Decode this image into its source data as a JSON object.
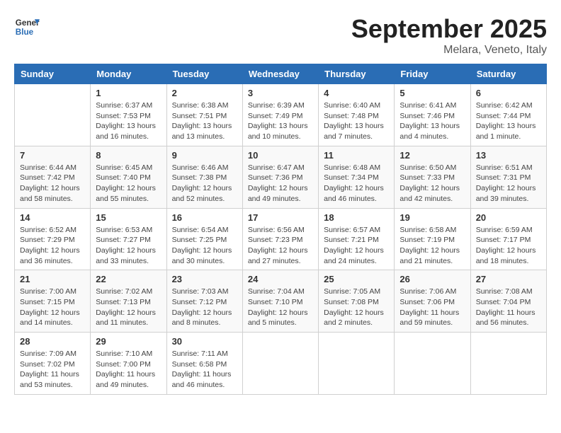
{
  "header": {
    "logo_general": "General",
    "logo_blue": "Blue",
    "month_title": "September 2025",
    "location": "Melara, Veneto, Italy"
  },
  "weekdays": [
    "Sunday",
    "Monday",
    "Tuesday",
    "Wednesday",
    "Thursday",
    "Friday",
    "Saturday"
  ],
  "weeks": [
    [
      {
        "day": "",
        "info": ""
      },
      {
        "day": "1",
        "info": "Sunrise: 6:37 AM\nSunset: 7:53 PM\nDaylight: 13 hours\nand 16 minutes."
      },
      {
        "day": "2",
        "info": "Sunrise: 6:38 AM\nSunset: 7:51 PM\nDaylight: 13 hours\nand 13 minutes."
      },
      {
        "day": "3",
        "info": "Sunrise: 6:39 AM\nSunset: 7:49 PM\nDaylight: 13 hours\nand 10 minutes."
      },
      {
        "day": "4",
        "info": "Sunrise: 6:40 AM\nSunset: 7:48 PM\nDaylight: 13 hours\nand 7 minutes."
      },
      {
        "day": "5",
        "info": "Sunrise: 6:41 AM\nSunset: 7:46 PM\nDaylight: 13 hours\nand 4 minutes."
      },
      {
        "day": "6",
        "info": "Sunrise: 6:42 AM\nSunset: 7:44 PM\nDaylight: 13 hours\nand 1 minute."
      }
    ],
    [
      {
        "day": "7",
        "info": "Sunrise: 6:44 AM\nSunset: 7:42 PM\nDaylight: 12 hours\nand 58 minutes."
      },
      {
        "day": "8",
        "info": "Sunrise: 6:45 AM\nSunset: 7:40 PM\nDaylight: 12 hours\nand 55 minutes."
      },
      {
        "day": "9",
        "info": "Sunrise: 6:46 AM\nSunset: 7:38 PM\nDaylight: 12 hours\nand 52 minutes."
      },
      {
        "day": "10",
        "info": "Sunrise: 6:47 AM\nSunset: 7:36 PM\nDaylight: 12 hours\nand 49 minutes."
      },
      {
        "day": "11",
        "info": "Sunrise: 6:48 AM\nSunset: 7:34 PM\nDaylight: 12 hours\nand 46 minutes."
      },
      {
        "day": "12",
        "info": "Sunrise: 6:50 AM\nSunset: 7:33 PM\nDaylight: 12 hours\nand 42 minutes."
      },
      {
        "day": "13",
        "info": "Sunrise: 6:51 AM\nSunset: 7:31 PM\nDaylight: 12 hours\nand 39 minutes."
      }
    ],
    [
      {
        "day": "14",
        "info": "Sunrise: 6:52 AM\nSunset: 7:29 PM\nDaylight: 12 hours\nand 36 minutes."
      },
      {
        "day": "15",
        "info": "Sunrise: 6:53 AM\nSunset: 7:27 PM\nDaylight: 12 hours\nand 33 minutes."
      },
      {
        "day": "16",
        "info": "Sunrise: 6:54 AM\nSunset: 7:25 PM\nDaylight: 12 hours\nand 30 minutes."
      },
      {
        "day": "17",
        "info": "Sunrise: 6:56 AM\nSunset: 7:23 PM\nDaylight: 12 hours\nand 27 minutes."
      },
      {
        "day": "18",
        "info": "Sunrise: 6:57 AM\nSunset: 7:21 PM\nDaylight: 12 hours\nand 24 minutes."
      },
      {
        "day": "19",
        "info": "Sunrise: 6:58 AM\nSunset: 7:19 PM\nDaylight: 12 hours\nand 21 minutes."
      },
      {
        "day": "20",
        "info": "Sunrise: 6:59 AM\nSunset: 7:17 PM\nDaylight: 12 hours\nand 18 minutes."
      }
    ],
    [
      {
        "day": "21",
        "info": "Sunrise: 7:00 AM\nSunset: 7:15 PM\nDaylight: 12 hours\nand 14 minutes."
      },
      {
        "day": "22",
        "info": "Sunrise: 7:02 AM\nSunset: 7:13 PM\nDaylight: 12 hours\nand 11 minutes."
      },
      {
        "day": "23",
        "info": "Sunrise: 7:03 AM\nSunset: 7:12 PM\nDaylight: 12 hours\nand 8 minutes."
      },
      {
        "day": "24",
        "info": "Sunrise: 7:04 AM\nSunset: 7:10 PM\nDaylight: 12 hours\nand 5 minutes."
      },
      {
        "day": "25",
        "info": "Sunrise: 7:05 AM\nSunset: 7:08 PM\nDaylight: 12 hours\nand 2 minutes."
      },
      {
        "day": "26",
        "info": "Sunrise: 7:06 AM\nSunset: 7:06 PM\nDaylight: 11 hours\nand 59 minutes."
      },
      {
        "day": "27",
        "info": "Sunrise: 7:08 AM\nSunset: 7:04 PM\nDaylight: 11 hours\nand 56 minutes."
      }
    ],
    [
      {
        "day": "28",
        "info": "Sunrise: 7:09 AM\nSunset: 7:02 PM\nDaylight: 11 hours\nand 53 minutes."
      },
      {
        "day": "29",
        "info": "Sunrise: 7:10 AM\nSunset: 7:00 PM\nDaylight: 11 hours\nand 49 minutes."
      },
      {
        "day": "30",
        "info": "Sunrise: 7:11 AM\nSunset: 6:58 PM\nDaylight: 11 hours\nand 46 minutes."
      },
      {
        "day": "",
        "info": ""
      },
      {
        "day": "",
        "info": ""
      },
      {
        "day": "",
        "info": ""
      },
      {
        "day": "",
        "info": ""
      }
    ]
  ]
}
